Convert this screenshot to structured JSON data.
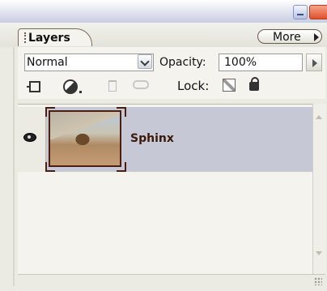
{
  "panel": {
    "tab_label": "Layers",
    "more_label": "More"
  },
  "options": {
    "blend_mode": "Normal",
    "opacity_label": "Opacity:",
    "opacity_value": "100%"
  },
  "lock": {
    "label": "Lock:"
  },
  "layers": [
    {
      "name": "Sphinx",
      "visible": true,
      "selected": true
    }
  ],
  "colors": {
    "selected_row": "#c6c8d6",
    "thumb_border": "#4a1e10"
  },
  "icons": [
    "eye-icon",
    "preserve-transparency-icon",
    "layer-mask-icon",
    "trash-icon",
    "link-icon",
    "lock-transparency-icon",
    "lock-all-icon",
    "more-arrow-icon",
    "dropdown-arrow-icon"
  ]
}
